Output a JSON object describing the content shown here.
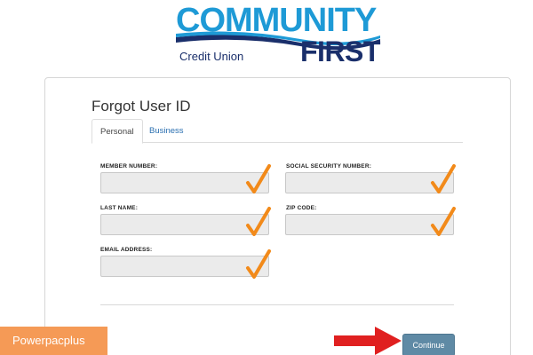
{
  "brand": {
    "top_word": "COMMUNITY",
    "bottom_word": "FIRST",
    "subtitle": "Credit Union",
    "primary_color": "#1e9ad6",
    "secondary_color": "#1a2f6b"
  },
  "page": {
    "title": "Forgot User ID"
  },
  "tabs": [
    {
      "label": "Personal",
      "active": true
    },
    {
      "label": "Business",
      "active": false
    }
  ],
  "form": {
    "member_number": {
      "label": "MEMBER NUMBER:",
      "value": ""
    },
    "ssn": {
      "label": "SOCIAL SECURITY NUMBER:",
      "value": ""
    },
    "last_name": {
      "label": "LAST NAME:",
      "value": ""
    },
    "zip_code": {
      "label": "ZIP CODE:",
      "value": ""
    },
    "email": {
      "label": "EMAIL ADDRESS:",
      "value": ""
    }
  },
  "annotation_colors": {
    "checkmark": "#f28a1a",
    "arrow": "#e02020"
  },
  "actions": {
    "continue_label": "Continue"
  },
  "watermark": {
    "text": "Powerpacplus",
    "color": "#f59a56"
  }
}
